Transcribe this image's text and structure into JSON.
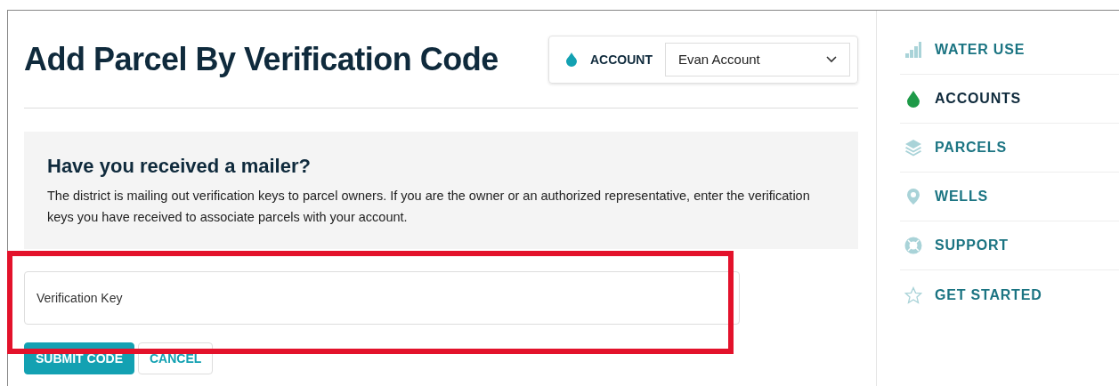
{
  "page_title": "Add Parcel By Verification Code",
  "account_picker": {
    "label": "ACCOUNT",
    "value": "Evan Account"
  },
  "notice": {
    "heading": "Have you received a mailer?",
    "text": "The district is mailing out verification keys to parcel owners. If you are the owner or an authorized representative, enter the verification keys you have received to associate parcels with your account."
  },
  "verification_field": {
    "placeholder": "Verification Key"
  },
  "buttons": [
    {
      "label": "SUBMIT CODE",
      "kind": "primary"
    },
    {
      "label": "CANCEL",
      "kind": "secondary"
    }
  ],
  "sidebar": {
    "items": [
      {
        "label": "WATER USE",
        "selected": false
      },
      {
        "label": "ACCOUNTS",
        "selected": true
      },
      {
        "label": "PARCELS",
        "selected": false
      },
      {
        "label": "WELLS",
        "selected": false
      },
      {
        "label": "SUPPORT",
        "selected": false
      },
      {
        "label": "GET STARTED",
        "selected": false
      }
    ]
  }
}
